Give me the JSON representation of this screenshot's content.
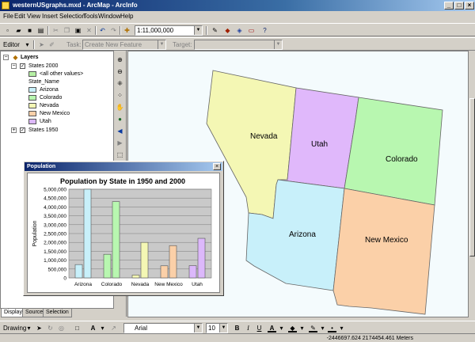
{
  "window": {
    "title": "westernUSgraphs.mxd - ArcMap - ArcInfo"
  },
  "menu": [
    "File",
    "Edit",
    "View",
    "Insert",
    "Selection",
    "Tools",
    "Window",
    "Help"
  ],
  "standard_toolbar": {
    "scale": "1:11,000,000"
  },
  "editor_toolbar": {
    "editor_label": "Editor",
    "task_label": "Task:",
    "task_value": "Create New Feature",
    "target_label": "Target:",
    "target_value": ""
  },
  "toc": {
    "root": "Layers",
    "layer1": {
      "name": "States 2000",
      "field": "State_Name",
      "classes": [
        {
          "label": "<all other values>",
          "color": "#b6f0a4"
        },
        {
          "label": "Arizona",
          "color": "#c8f0fa"
        },
        {
          "label": "Colorado",
          "color": "#b8f7b0"
        },
        {
          "label": "Nevada",
          "color": "#f4f7b4"
        },
        {
          "label": "New Mexico",
          "color": "#fbd0a8"
        },
        {
          "label": "Utah",
          "color": "#dcb8fb"
        }
      ]
    },
    "layer2": {
      "name": "States 1950"
    },
    "tabs": [
      "Display",
      "Source",
      "Selection"
    ]
  },
  "map": {
    "labels": {
      "nevada": "Nevada",
      "utah": "Utah",
      "colorado": "Colorado",
      "arizona": "Arizona",
      "new_mexico": "New Mexico"
    },
    "colors": {
      "nevada": "#f4f7b4",
      "utah": "#e0b8fb",
      "colorado": "#b8f7b0",
      "arizona": "#c8f0fa",
      "new_mexico": "#fbd0a8"
    }
  },
  "popup": {
    "title": "Population"
  },
  "chart_data": {
    "type": "bar",
    "title": "Population by State in 1950 and 2000",
    "ylabel": "Population",
    "xlabel": "",
    "categories": [
      "Arizona",
      "Colorado",
      "Nevada",
      "New Mexico",
      "Utah"
    ],
    "ylim": [
      0,
      5000000
    ],
    "yticks": [
      "0",
      "500,000",
      "1,000,000",
      "1,500,000",
      "2,000,000",
      "2,500,000",
      "3,000,000",
      "3,500,000",
      "4,000,000",
      "4,500,000",
      "5,000,000"
    ],
    "series": [
      {
        "values": [
          750000,
          1330000,
          160000,
          680000,
          690000
        ]
      },
      {
        "values": [
          5130000,
          4300000,
          2000000,
          1820000,
          2230000
        ]
      }
    ],
    "bar_colors": [
      "#c8f0fa",
      "#b8f7b0",
      "#f4f7b4",
      "#fbd0a8",
      "#dcb8fb"
    ],
    "grid": true
  },
  "drawing_toolbar": {
    "label": "Drawing",
    "font": "Arial",
    "size": "10"
  },
  "status": {
    "coords": "-2446697.624  2174454.461 Meters"
  }
}
